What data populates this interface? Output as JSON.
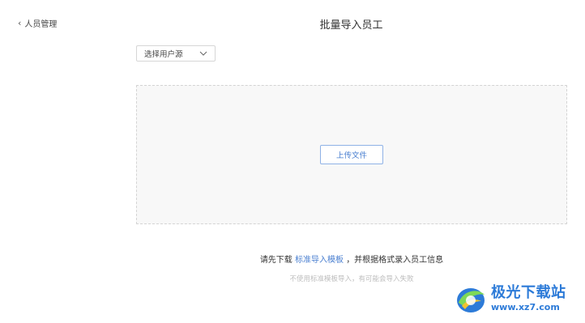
{
  "nav": {
    "back_label": "人员管理"
  },
  "page": {
    "title": "批量导入员工"
  },
  "source_select": {
    "placeholder": "选择用户源"
  },
  "dropzone": {
    "upload_label": "上传文件"
  },
  "hint": {
    "prefix": "请先下载",
    "link": "标准导入模板",
    "suffix": "，并根据格式录入员工信息"
  },
  "subhint": "不使用标准模板导入，有可能会导入失败",
  "watermark": {
    "name": "极光下载站",
    "url": "www.xz7.com"
  },
  "colors": {
    "accent": "#4a7fd0",
    "border": "#d6d6d6",
    "dropzone_bg": "#f8f8f8"
  }
}
